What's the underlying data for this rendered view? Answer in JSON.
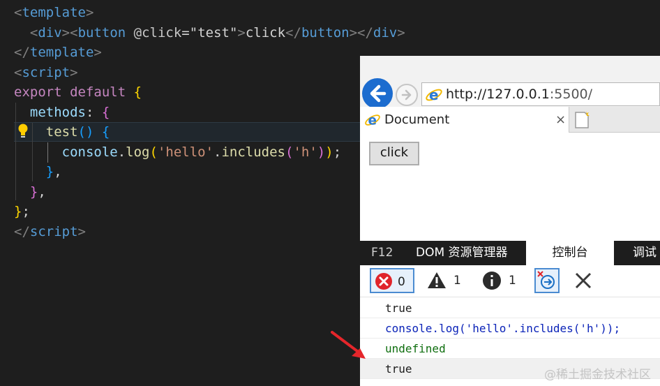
{
  "editor": {
    "lines": [
      [
        [
          "tk-tag",
          "<"
        ],
        [
          "tk-tagname",
          "template"
        ],
        [
          "tk-tag",
          ">"
        ]
      ],
      [
        [
          "tk-text",
          "  "
        ],
        [
          "tk-tag",
          "<"
        ],
        [
          "tk-tagname",
          "div"
        ],
        [
          "tk-tag",
          "><"
        ],
        [
          "tk-tagname",
          "button"
        ],
        [
          "tk-text",
          " "
        ],
        [
          "tk-attr",
          "@click"
        ],
        [
          "tk-text",
          "="
        ],
        [
          "tk-attrval",
          "\"test\""
        ],
        [
          "tk-tag",
          ">"
        ],
        [
          "tk-text",
          "click"
        ],
        [
          "tk-tag",
          "</"
        ],
        [
          "tk-tagname",
          "button"
        ],
        [
          "tk-tag",
          "></"
        ],
        [
          "tk-tagname",
          "div"
        ],
        [
          "tk-tag",
          ">"
        ]
      ],
      [
        [
          "tk-tag",
          "</"
        ],
        [
          "tk-tagname",
          "template"
        ],
        [
          "tk-tag",
          ">"
        ]
      ],
      [
        [
          "tk-tag",
          "<"
        ],
        [
          "tk-tagname",
          "script"
        ],
        [
          "tk-tag",
          ">"
        ]
      ],
      [
        [
          "tk-kw",
          "export"
        ],
        [
          "tk-text",
          " "
        ],
        [
          "tk-kw",
          "default"
        ],
        [
          "tk-text",
          " "
        ],
        [
          "tk-br1",
          "{"
        ]
      ],
      [
        [
          "tk-text",
          "  "
        ],
        [
          "tk-prop",
          "methods"
        ],
        [
          "tk-punc",
          ": "
        ],
        [
          "tk-br2",
          "{"
        ]
      ],
      [
        [
          "tk-text",
          "    "
        ],
        [
          "tk-fn",
          "test"
        ],
        [
          "tk-br3",
          "()"
        ],
        [
          "tk-text",
          " "
        ],
        [
          "tk-br3",
          "{"
        ]
      ],
      [
        [
          "tk-text",
          "      "
        ],
        [
          "tk-prop",
          "console"
        ],
        [
          "tk-punc",
          "."
        ],
        [
          "tk-fn",
          "log"
        ],
        [
          "tk-br1",
          "("
        ],
        [
          "tk-string",
          "'hello'"
        ],
        [
          "tk-punc",
          "."
        ],
        [
          "tk-fn",
          "includes"
        ],
        [
          "tk-br2",
          "("
        ],
        [
          "tk-string",
          "'h'"
        ],
        [
          "tk-br2",
          ")"
        ],
        [
          "tk-br1",
          ")"
        ],
        [
          "tk-punc",
          ";"
        ]
      ],
      [
        [
          "tk-text",
          "    "
        ],
        [
          "tk-br3",
          "}"
        ],
        [
          "tk-punc",
          ","
        ]
      ],
      [
        [
          "tk-text",
          "  "
        ],
        [
          "tk-br2",
          "}"
        ],
        [
          "tk-punc",
          ","
        ]
      ],
      [
        [
          "tk-br1",
          "}"
        ],
        [
          "tk-punc",
          ";"
        ]
      ],
      [
        [
          "tk-tag",
          "</"
        ],
        [
          "tk-tagname",
          "script"
        ],
        [
          "tk-tag",
          ">"
        ]
      ]
    ]
  },
  "browser": {
    "address_host": "http://127.0.0.1",
    "address_port": ":5500/",
    "tab_title": "Document",
    "tab_close": "×",
    "page_button_label": "click"
  },
  "devtools": {
    "tab_f12": "F12",
    "tab_dom": "DOM 资源管理器",
    "tab_console": "控制台",
    "tab_debugger": "调试",
    "error_count": "0",
    "warning_count": "1",
    "info_count": "1",
    "console_lines": [
      {
        "text": "true",
        "kind": "con-result"
      },
      {
        "text": "console.log('hello'.includes('h'));",
        "kind": "con-input"
      },
      {
        "text": "undefined",
        "kind": "con-undef"
      },
      {
        "text": "true",
        "kind": "con-result con-last"
      }
    ]
  },
  "watermark": "@稀土掘金技术社区",
  "colors": {
    "editor_bg": "#1e1e1e",
    "ie_blue": "#1c6ccf",
    "arrow_red": "#e5262b"
  }
}
